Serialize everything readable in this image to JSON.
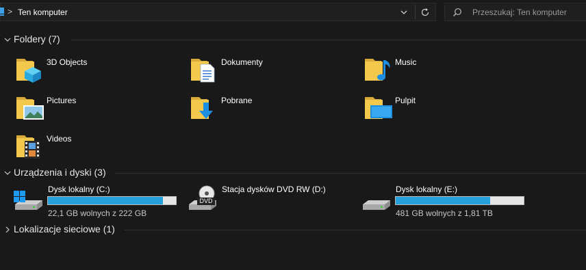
{
  "address_bar": {
    "separator": ">",
    "location": "Ten komputer",
    "search_placeholder": "Przeszukaj: Ten komputer"
  },
  "groups": {
    "folders": {
      "title": "Foldery (7)"
    },
    "devices": {
      "title": "Urządzenia i dyski (3)"
    },
    "network": {
      "title": "Lokalizacje sieciowe (1)"
    }
  },
  "folders": [
    {
      "label": "3D Objects",
      "icon": "3d-objects-folder-icon"
    },
    {
      "label": "Dokumenty",
      "icon": "documents-folder-icon"
    },
    {
      "label": "Music",
      "icon": "music-folder-icon"
    },
    {
      "label": "Pictures",
      "icon": "pictures-folder-icon"
    },
    {
      "label": "Pobrane",
      "icon": "downloads-folder-icon"
    },
    {
      "label": "Pulpit",
      "icon": "desktop-folder-icon"
    },
    {
      "label": "Videos",
      "icon": "videos-folder-icon"
    }
  ],
  "drives": [
    {
      "name": "Dysk lokalny (C:)",
      "free": "22,1 GB wolnych z 222 GB",
      "used_fraction": 0.9,
      "icon": "windows-drive-icon"
    },
    {
      "name": "Stacja dysków DVD RW (D:)",
      "badge": "DVD",
      "icon": "dvd-drive-icon"
    },
    {
      "name": "Dysk lokalny (E:)",
      "free": "481 GB wolnych z 1,81 TB",
      "used_fraction": 0.74,
      "icon": "hard-drive-icon"
    }
  ],
  "colors": {
    "background": "#191919",
    "progress_fill": "#26a0da",
    "progress_track": "#e6e6e6",
    "folder_yellow": "#f2c94c"
  }
}
